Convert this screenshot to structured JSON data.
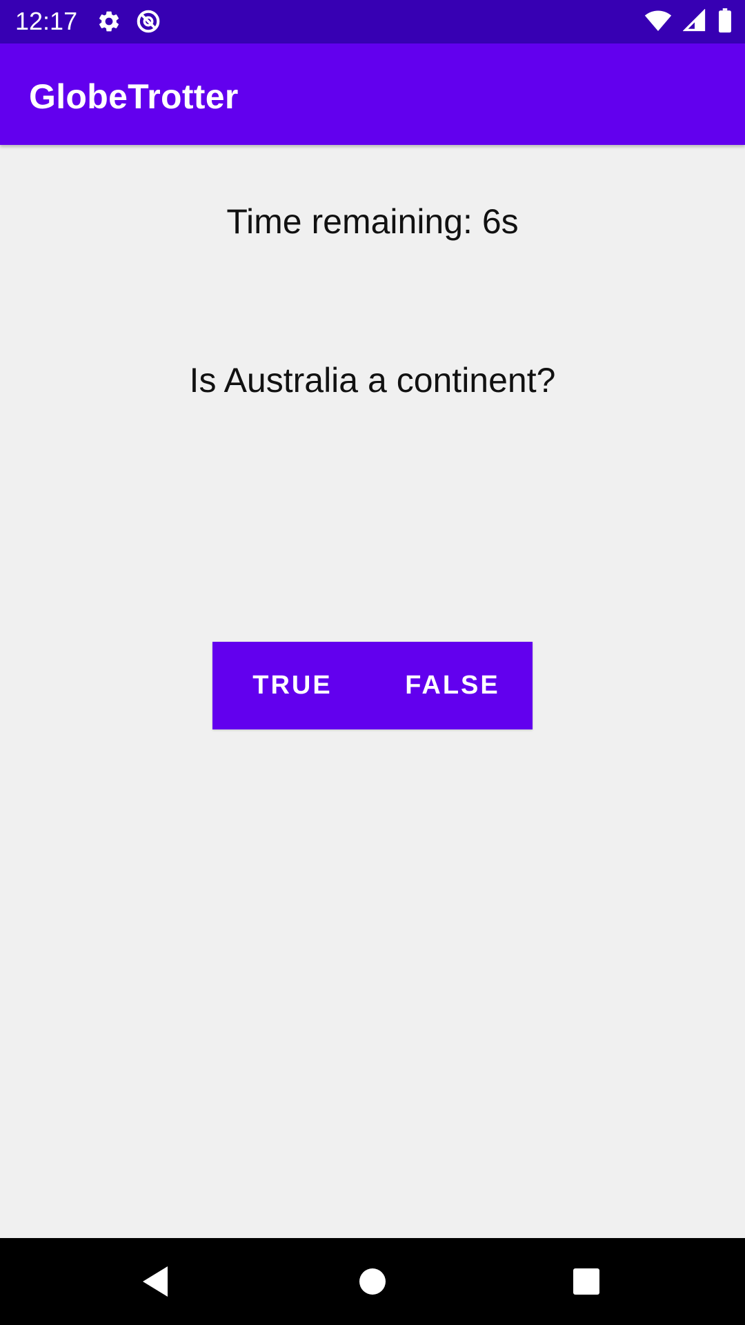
{
  "status_bar": {
    "time": "12:17",
    "icons": [
      "settings-icon",
      "do-not-disturb-icon",
      "wifi-icon",
      "signal-icon",
      "battery-icon"
    ],
    "background": "#3700b3"
  },
  "app_bar": {
    "title": "GlobeTrotter",
    "background": "#6200ee"
  },
  "quiz": {
    "timer_text": "Time remaining: 6s",
    "question": "Is Australia a continent?",
    "true_label": "TRUE",
    "false_label": "FALSE",
    "button_color": "#6200ee"
  },
  "nav_bar": {
    "icons": [
      "back-icon",
      "home-icon",
      "recents-icon"
    ]
  }
}
